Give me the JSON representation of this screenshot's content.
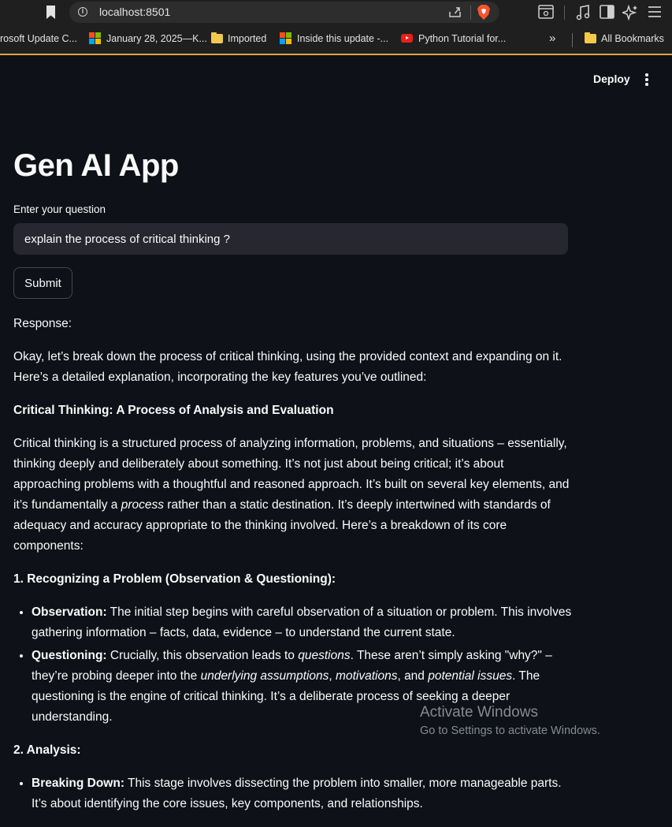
{
  "browser": {
    "url": "localhost:8501",
    "bookmarks": [
      {
        "label": "rosoft Update C...",
        "icon": "none"
      },
      {
        "label": "January 28, 2025—K...",
        "icon": "microsoft-logo-icon"
      },
      {
        "label": "Imported",
        "icon": "folder-icon"
      },
      {
        "label": "Inside this update -...",
        "icon": "microsoft-logo-icon"
      },
      {
        "label": "Python Tutorial for...",
        "icon": "youtube-icon"
      },
      {
        "label": "»",
        "icon": "none"
      },
      {
        "label": "All Bookmarks",
        "icon": "folder-icon"
      }
    ]
  },
  "toolbar": {
    "deploy_label": "Deploy"
  },
  "app": {
    "title": "Gen AI App",
    "question_label": "Enter your question",
    "question_value": "explain the process of critical thinking ?",
    "submit_label": "Submit",
    "response_label": "Response:"
  },
  "response": {
    "intro": "Okay, let’s break down the process of critical thinking, using the provided context and expanding on it. Here’s a detailed explanation, incorporating the key features you’ve outlined:",
    "heading": "Critical Thinking: A Process of Analysis and Evaluation",
    "para_before_em": "Critical thinking is a structured process of analyzing information, problems, and situations – essentially, thinking deeply and deliberately about something. It’s not just about being critical; it’s about approaching problems with a thoughtful and reasoned approach. It’s built on several key elements, and it’s fundamentally a ",
    "para_em": "process",
    "para_after_em": " rather than a static destination. It’s deeply intertwined with standards of adequacy and accuracy appropriate to the thinking involved. Here’s a breakdown of its core components:",
    "section1_heading": "1. Recognizing a Problem (Observation & Questioning):",
    "obs_label": "Observation:",
    "obs_text": " The initial step begins with careful observation of a situation or problem. This involves gathering information – facts, data, evidence – to understand the current state.",
    "q_label": "Questioning:",
    "q_text1": " Crucially, this observation leads to ",
    "q_em1": "questions",
    "q_text2": ". These aren’t simply asking \"why?\" – they’re probing deeper into the ",
    "q_em2": "underlying assumptions",
    "q_text3": ", ",
    "q_em3": "motivations",
    "q_text4": ", and ",
    "q_em4": "potential issues",
    "q_text5": ". The questioning is the engine of critical thinking. It’s a deliberate process of seeking a deeper understanding.",
    "section2_heading": "2. Analysis:",
    "bd_label": "Breaking Down:",
    "bd_text": " This stage involves dissecting the problem into smaller, more manageable parts. It’s about identifying the core issues, key components, and relationships."
  },
  "watermark": {
    "line1": "Activate Windows",
    "line2": "Go to Settings to activate Windows."
  },
  "colors": {
    "background": "#0e1117",
    "text": "#fafafa",
    "input_bg": "#262730",
    "browser_chrome": "#1f1f1f",
    "accent_line": "#e8a33d"
  }
}
